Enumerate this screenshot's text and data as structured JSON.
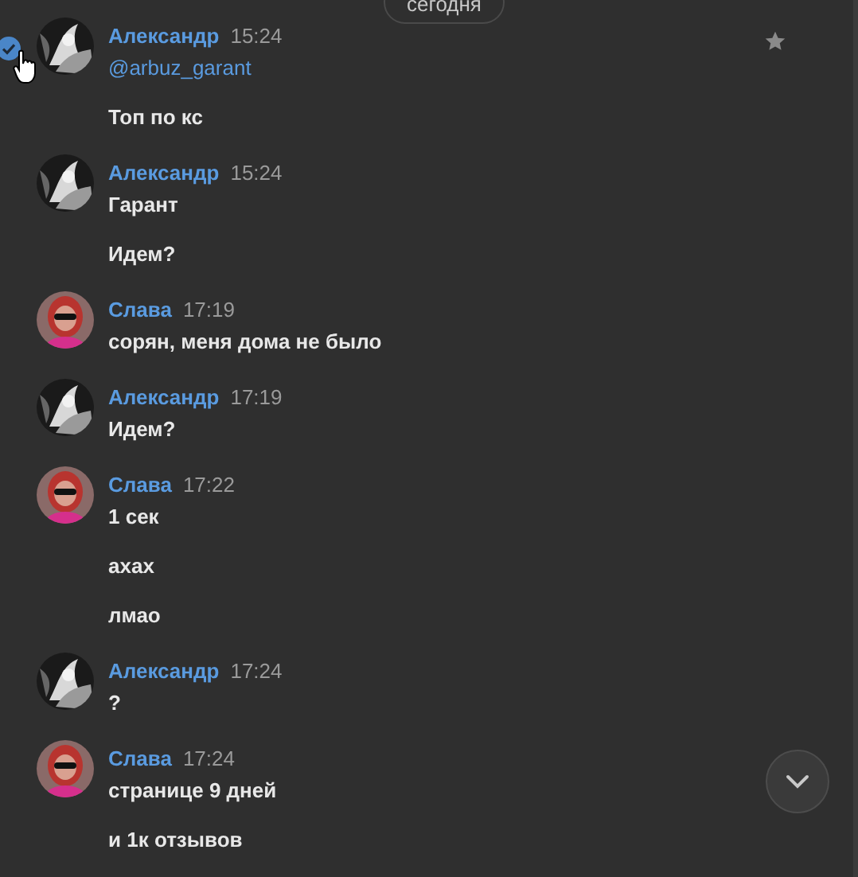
{
  "date_separator": "сегодня",
  "messages": [
    {
      "author": "Александр",
      "time": "15:24",
      "avatar": {
        "kind": "picture",
        "color": "#1a1a1a"
      },
      "selected": true,
      "hovered": true,
      "cursor": true,
      "lines": [
        {
          "kind": "mention",
          "text": "@arbuz_garant"
        },
        {
          "kind": "text",
          "text": "Топ по кс"
        }
      ]
    },
    {
      "author": "Александр",
      "time": "15:24",
      "avatar": {
        "kind": "picture",
        "color": "#1a1a1a"
      },
      "selected": false,
      "hovered": false,
      "cursor": false,
      "lines": [
        {
          "kind": "text",
          "text": "Гарант"
        },
        {
          "kind": "text",
          "text": "Идем?"
        }
      ]
    },
    {
      "author": "Слава",
      "time": "17:19",
      "avatar": {
        "kind": "picture",
        "color": "#8a6a68"
      },
      "selected": false,
      "hovered": false,
      "cursor": false,
      "lines": [
        {
          "kind": "text",
          "text": "сорян, меня дома не было"
        }
      ]
    },
    {
      "author": "Александр",
      "time": "17:19",
      "avatar": {
        "kind": "picture",
        "color": "#1a1a1a"
      },
      "selected": false,
      "hovered": false,
      "cursor": false,
      "lines": [
        {
          "kind": "text",
          "text": "Идем?"
        }
      ]
    },
    {
      "author": "Слава",
      "time": "17:22",
      "avatar": {
        "kind": "picture",
        "color": "#8a6a68"
      },
      "selected": false,
      "hovered": false,
      "cursor": false,
      "lines": [
        {
          "kind": "text",
          "text": "1 сек"
        },
        {
          "kind": "text",
          "text": "ахах"
        },
        {
          "kind": "text",
          "text": "лмао"
        }
      ]
    },
    {
      "author": "Александр",
      "time": "17:24",
      "avatar": {
        "kind": "picture",
        "color": "#1a1a1a"
      },
      "selected": false,
      "hovered": false,
      "cursor": false,
      "lines": [
        {
          "kind": "text",
          "text": "?"
        }
      ]
    },
    {
      "author": "Слава",
      "time": "17:24",
      "avatar": {
        "kind": "picture",
        "color": "#8a6a68"
      },
      "selected": false,
      "hovered": false,
      "cursor": false,
      "lines": [
        {
          "kind": "text",
          "text": "странице 9 дней"
        },
        {
          "kind": "text",
          "text": "и 1к отзывов"
        }
      ]
    }
  ]
}
